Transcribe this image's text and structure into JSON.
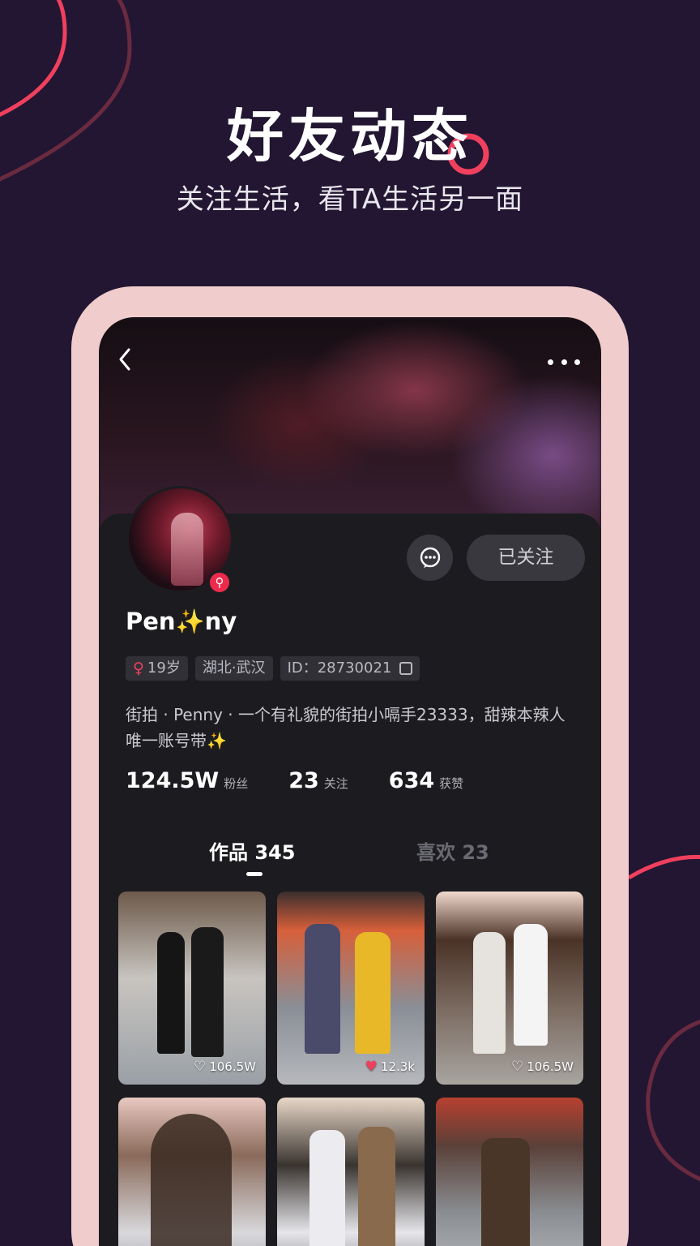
{
  "promo": {
    "title": "好友动态",
    "subtitle": "关注生活，看TA生活另一面"
  },
  "profile": {
    "nickname": "Pen✨ny",
    "gender_age": "19岁",
    "location": "湖北·武汉",
    "user_id": "ID：28730021",
    "bio": "街拍 · Penny · 一个有礼貌的街拍小嗝手23333，甜辣本辣人唯一账号带✨",
    "follow_button": "已关注",
    "stats": [
      {
        "value": "124.5W",
        "label": "粉丝"
      },
      {
        "value": "23",
        "label": "关注"
      },
      {
        "value": "634",
        "label": "获赞"
      }
    ]
  },
  "tabs": [
    {
      "label": "作品 345",
      "active": true
    },
    {
      "label": "喜欢 23",
      "active": false
    }
  ],
  "posts": [
    {
      "likes": "106.5W",
      "liked": false
    },
    {
      "likes": "12.3k",
      "liked": true
    },
    {
      "likes": "106.5W",
      "liked": false
    },
    {
      "likes": "",
      "liked": false
    },
    {
      "likes": "",
      "liked": false
    },
    {
      "likes": "",
      "liked": false
    }
  ],
  "colors": {
    "background": "#221632",
    "accent": "#f0405e",
    "phone_frame": "#f1cccc",
    "screen": "#1c1c20"
  }
}
